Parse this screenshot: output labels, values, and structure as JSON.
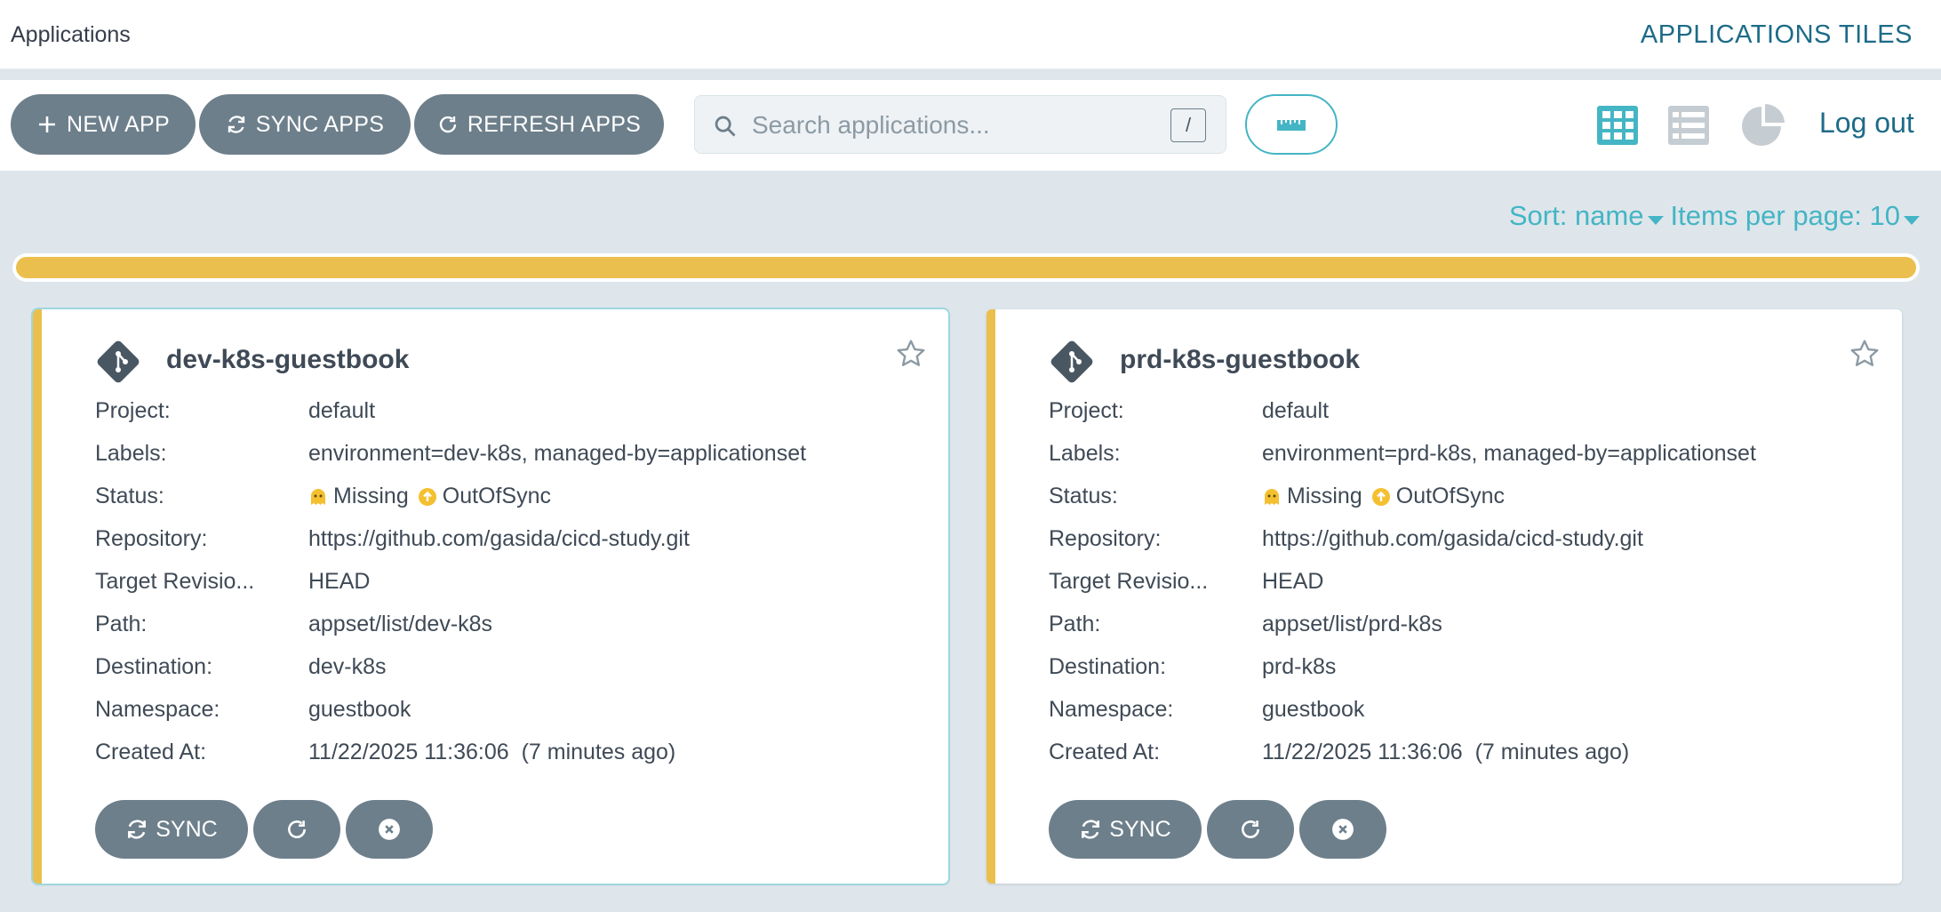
{
  "header": {
    "title": "Applications",
    "view_title": "APPLICATIONS TILES"
  },
  "toolbar": {
    "new_app": "NEW APP",
    "sync_apps": "SYNC APPS",
    "refresh_apps": "REFRESH APPS",
    "search_placeholder": "Search applications...",
    "search_shortcut": "/",
    "logout": "Log out"
  },
  "sort": {
    "sort_label": "Sort: name",
    "per_page_label": "Items per page: 10"
  },
  "colors": {
    "accent": "#44b5c4",
    "status_outofsync": "#ebbf4d",
    "button": "#6d7f8b"
  },
  "labels": {
    "project": "Project:",
    "labels": "Labels:",
    "status": "Status:",
    "repository": "Repository:",
    "target_revision": "Target Revisio...",
    "path": "Path:",
    "destination": "Destination:",
    "namespace": "Namespace:",
    "created_at": "Created At:"
  },
  "apps": [
    {
      "name": "dev-k8s-guestbook",
      "project": "default",
      "labels": "environment=dev-k8s, managed-by=applicationset",
      "health": "Missing",
      "sync": "OutOfSync",
      "repository": "https://github.com/gasida/cicd-study.git",
      "target_revision": "HEAD",
      "path": "appset/list/dev-k8s",
      "destination": "dev-k8s",
      "namespace": "guestbook",
      "created_at": "11/22/2025 11:36:06  (7 minutes ago)",
      "sync_button": "SYNC"
    },
    {
      "name": "prd-k8s-guestbook",
      "project": "default",
      "labels": "environment=prd-k8s, managed-by=applicationset",
      "health": "Missing",
      "sync": "OutOfSync",
      "repository": "https://github.com/gasida/cicd-study.git",
      "target_revision": "HEAD",
      "path": "appset/list/prd-k8s",
      "destination": "prd-k8s",
      "namespace": "guestbook",
      "created_at": "11/22/2025 11:36:06  (7 minutes ago)",
      "sync_button": "SYNC"
    }
  ]
}
